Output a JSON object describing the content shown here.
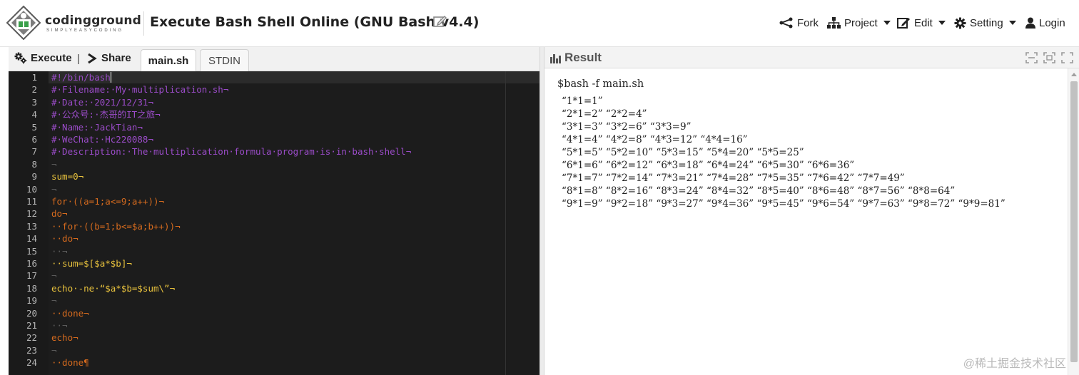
{
  "header": {
    "logo_text": "codingground",
    "logo_tagline": "SIMPLYEASYCODING",
    "title": "Execute Bash Shell Online (GNU Bash v4.4)",
    "nav": {
      "fork": "Fork",
      "project": "Project",
      "edit": "Edit",
      "setting": "Setting",
      "login": "Login"
    }
  },
  "editor": {
    "toolbar": {
      "execute": "Execute",
      "separator": "|",
      "share": "Share"
    },
    "tabs": [
      "main.sh",
      "STDIN"
    ],
    "active_tab": "main.sh",
    "line_numbers": [
      "1",
      "2",
      "3",
      "4",
      "5",
      "6",
      "7",
      "8",
      "9",
      "10",
      "11",
      "12",
      "13",
      "14",
      "15",
      "16",
      "17",
      "18",
      "19",
      "20",
      "21",
      "22",
      "23",
      "24"
    ],
    "lines": [
      "#!/bin/bash",
      "#·Filename:·My·multiplication.sh¬",
      "#·Date:·2021/12/31¬",
      "#·公众号:·杰哥的IT之旅¬",
      "#·Name:·JackTian¬",
      "#·WeChat:·Hc220088¬",
      "#·Description:·The·multiplication·formula·program·is·in·bash·shell¬",
      "¬",
      "sum=0¬",
      "¬",
      "for·((a=1;a<=9;a++))¬",
      "do¬",
      "··for·((b=1;b<=$a;b++))¬",
      "··do¬",
      "··¬",
      "··sum=$[$a*$b]¬",
      "¬",
      "echo·-ne·“$a*$b=$sum\\”¬",
      "¬",
      "··done¬",
      "··¬",
      "echo¬",
      "¬",
      "··done¶"
    ]
  },
  "result": {
    "title": "Result",
    "command": "$bash -f main.sh",
    "output": [
      "“1*1=1”",
      "“2*1=2” “2*2=4”",
      "“3*1=3” “3*2=6” “3*3=9”",
      "“4*1=4” “4*2=8” “4*3=12” “4*4=16”",
      "“5*1=5” “5*2=10” “5*3=15” “5*4=20” “5*5=25”",
      "“6*1=6” “6*2=12” “6*3=18” “6*4=24” “6*5=30” “6*6=36”",
      "“7*1=7” “7*2=14” “7*3=21” “7*4=28” “7*5=35” “7*6=42” “7*7=49”",
      "“8*1=8” “8*2=16” “8*3=24” “8*4=32” “8*5=40” “8*6=48” “8*7=56” “8*8=64”",
      "“9*1=9” “9*2=18” “9*3=27” “9*4=36” “9*5=45” “9*6=54” “9*7=63” “9*8=72” “9*9=81”"
    ],
    "watermark": "@稀土掘金技术社区"
  },
  "colors": {
    "comment": "#9b4cc9",
    "keyword": "#d46a1e",
    "variable": "#e8c23d",
    "editor_bg": "#1c1c1c"
  }
}
